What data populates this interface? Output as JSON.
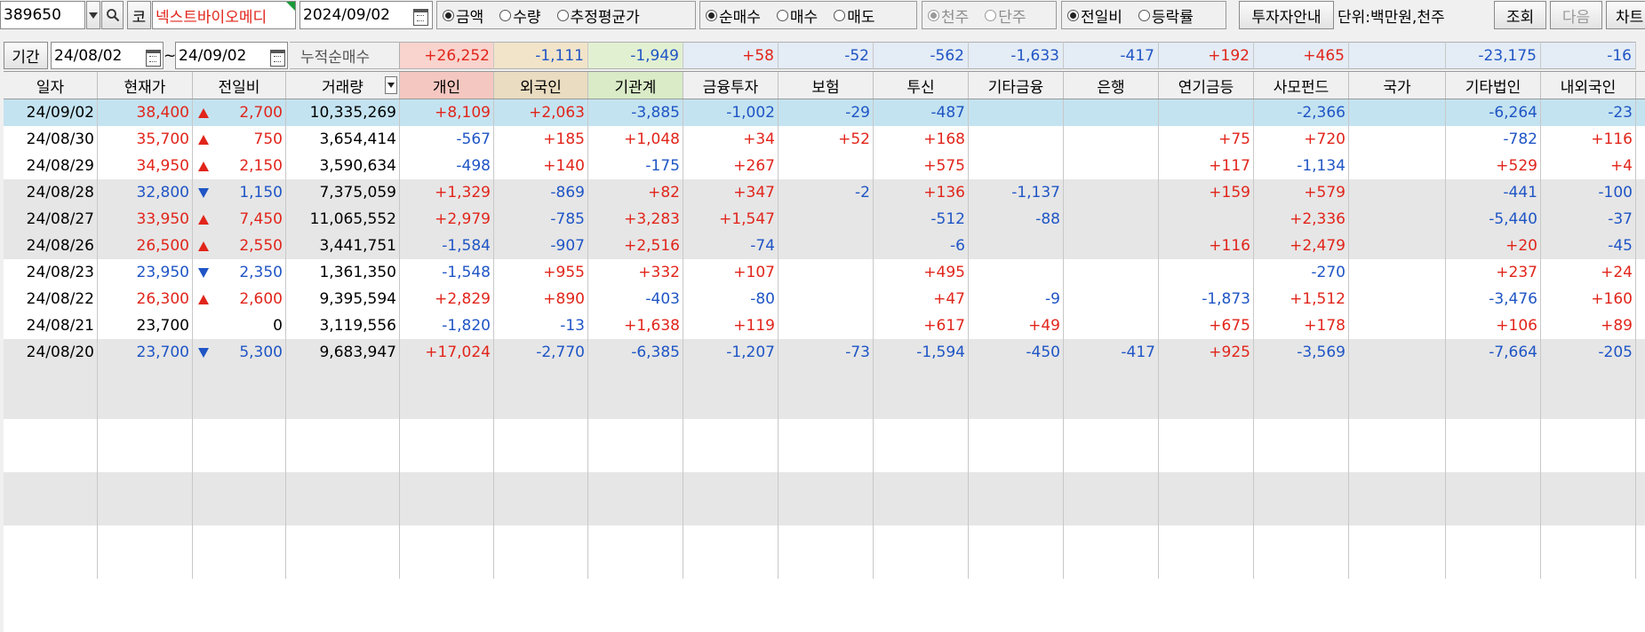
{
  "toolbar": {
    "code": "389650",
    "code_btn": "코",
    "stock_name": "넥스트바이오메디",
    "date": "2024/09/02",
    "value_type": [
      {
        "label": "금액",
        "on": true
      },
      {
        "label": "수량",
        "on": false
      },
      {
        "label": "추정평균가",
        "on": false
      }
    ],
    "trade_type": [
      {
        "label": "순매수",
        "on": true
      },
      {
        "label": "매수",
        "on": false
      },
      {
        "label": "매도",
        "on": false
      }
    ],
    "unit_type": [
      {
        "label": "천주",
        "on": true
      },
      {
        "label": "단주",
        "on": false
      }
    ],
    "compare_type": [
      {
        "label": "전일비",
        "on": true
      },
      {
        "label": "등락률",
        "on": false
      }
    ],
    "investor_guide": "투자자안내",
    "unit_text": "단위:백만원,천주",
    "query_btn": "조회",
    "next_btn": "다음",
    "chart_btn": "차트"
  },
  "period": {
    "label": "기간",
    "from": "24/08/02",
    "tilde": "~",
    "to": "24/09/02",
    "cum_label": "누적순매수",
    "sums": [
      "+26,252",
      "-1,111",
      "-1,949",
      "+58",
      "-52",
      "-562",
      "-1,633",
      "-417",
      "+192",
      "+465",
      "",
      "-23,175",
      "-16"
    ]
  },
  "columns": [
    "일자",
    "현재가",
    "전일비",
    "거래량",
    "개인",
    "외국인",
    "기관계",
    "금융투자",
    "보험",
    "투신",
    "기타금융",
    "은행",
    "연기금등",
    "사모펀드",
    "국가",
    "기타법인",
    "내외국인"
  ],
  "header_colors": {
    "개인": "#f4c7c0",
    "외국인": "#e9dcc0",
    "기관계": "#d9ebc7"
  },
  "rows": [
    {
      "date": "24/09/02",
      "price": "38,400",
      "dir": "up",
      "chg": "2,700",
      "vol": "10,335,269",
      "v": [
        "+8,109",
        "+2,063",
        "-3,885",
        "-1,002",
        "-29",
        "-487",
        "",
        "",
        "",
        "-2,366",
        "",
        "-6,264",
        "-23"
      ]
    },
    {
      "date": "24/08/30",
      "price": "35,700",
      "dir": "up",
      "chg": "750",
      "vol": "3,654,414",
      "v": [
        "-567",
        "+185",
        "+1,048",
        "+34",
        "+52",
        "+168",
        "",
        "",
        "+75",
        "+720",
        "",
        "-782",
        "+116"
      ]
    },
    {
      "date": "24/08/29",
      "price": "34,950",
      "dir": "up",
      "chg": "2,150",
      "vol": "3,590,634",
      "v": [
        "-498",
        "+140",
        "-175",
        "+267",
        "",
        "+575",
        "",
        "",
        "+117",
        "-1,134",
        "",
        "+529",
        "+4"
      ]
    },
    {
      "date": "24/08/28",
      "price": "32,800",
      "dir": "dn",
      "chg": "1,150",
      "vol": "7,375,059",
      "v": [
        "+1,329",
        "-869",
        "+82",
        "+347",
        "-2",
        "+136",
        "-1,137",
        "",
        "+159",
        "+579",
        "",
        "-441",
        "-100"
      ]
    },
    {
      "date": "24/08/27",
      "price": "33,950",
      "dir": "up",
      "chg": "7,450",
      "vol": "11,065,552",
      "v": [
        "+2,979",
        "-785",
        "+3,283",
        "+1,547",
        "",
        "-512",
        "-88",
        "",
        "",
        "+2,336",
        "",
        "-5,440",
        "-37"
      ]
    },
    {
      "date": "24/08/26",
      "price": "26,500",
      "dir": "up",
      "chg": "2,550",
      "vol": "3,441,751",
      "v": [
        "-1,584",
        "-907",
        "+2,516",
        "-74",
        "",
        "-6",
        "",
        "",
        "+116",
        "+2,479",
        "",
        "+20",
        "-45"
      ]
    },
    {
      "date": "24/08/23",
      "price": "23,950",
      "dir": "dn",
      "chg": "2,350",
      "vol": "1,361,350",
      "v": [
        "-1,548",
        "+955",
        "+332",
        "+107",
        "",
        "+495",
        "",
        "",
        "",
        "-270",
        "",
        "+237",
        "+24"
      ]
    },
    {
      "date": "24/08/22",
      "price": "26,300",
      "dir": "up",
      "chg": "2,600",
      "vol": "9,395,594",
      "v": [
        "+2,829",
        "+890",
        "-403",
        "-80",
        "",
        "+47",
        "-9",
        "",
        "-1,873",
        "+1,512",
        "",
        "-3,476",
        "+160"
      ]
    },
    {
      "date": "24/08/21",
      "price": "23,700",
      "dir": "",
      "chg": "0",
      "vol": "3,119,556",
      "v": [
        "-1,820",
        "-13",
        "+1,638",
        "+119",
        "",
        "+617",
        "+49",
        "",
        "+675",
        "+178",
        "",
        "+106",
        "+89"
      ]
    },
    {
      "date": "24/08/20",
      "price": "23,700",
      "dir": "dn",
      "chg": "5,300",
      "vol": "9,683,947",
      "v": [
        "+17,024",
        "-2,770",
        "-6,385",
        "-1,207",
        "-73",
        "-1,594",
        "-450",
        "-417",
        "+925",
        "-3,569",
        "",
        "-7,664",
        "-205"
      ]
    }
  ]
}
